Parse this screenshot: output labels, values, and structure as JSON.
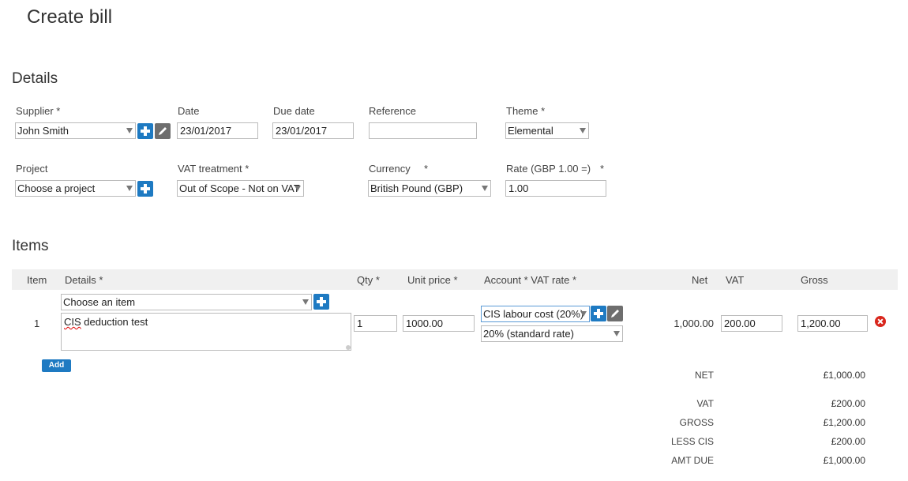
{
  "page_title": "Create bill",
  "details": {
    "heading": "Details",
    "supplier": {
      "label": "Supplier *",
      "value": "John Smith"
    },
    "date": {
      "label": "Date",
      "value": "23/01/2017"
    },
    "due_date": {
      "label": "Due date",
      "value": "23/01/2017"
    },
    "reference": {
      "label": "Reference",
      "value": ""
    },
    "theme": {
      "label": "Theme *",
      "value": "Elemental"
    },
    "project": {
      "label": "Project",
      "value": "Choose a project"
    },
    "vat_treatment": {
      "label": "VAT treatment *",
      "value": "Out of Scope - Not on VAT"
    },
    "currency": {
      "label": "Currency",
      "required_mark": "*",
      "value": "British Pound (GBP)"
    },
    "rate": {
      "label": "Rate (GBP 1.00 =)",
      "required_mark": "*",
      "value": "1.00"
    }
  },
  "items": {
    "heading": "Items",
    "columns": {
      "item": "Item",
      "details": "Details *",
      "qty": "Qty *",
      "unit_price": "Unit price *",
      "account_vat": "Account * VAT rate *",
      "net": "Net",
      "vat": "VAT",
      "gross": "Gross"
    },
    "rows": [
      {
        "item_no": "1",
        "item_select": "Choose an item",
        "details_prefix": "CIS",
        "details_rest": " deduction test",
        "qty": "1",
        "unit_price": "1000.00",
        "account": "CIS labour cost (20%)",
        "vat_rate": "20% (standard rate)",
        "net": "1,000.00",
        "vat": "200.00",
        "gross": "1,200.00"
      }
    ],
    "add_label": "Add"
  },
  "totals": [
    {
      "label": "NET",
      "value": "£1,000.00"
    },
    {
      "label": "VAT",
      "value": "£200.00"
    },
    {
      "label": "GROSS",
      "value": "£1,200.00"
    },
    {
      "label": "LESS CIS",
      "value": "£200.00"
    },
    {
      "label": "AMT DUE",
      "value": "£1,000.00"
    }
  ],
  "colors": {
    "accent": "#1e7ac2",
    "edit_button": "#6e6e6e",
    "delete": "#d9261c",
    "table_header": "#f0f0f0"
  },
  "icons": {
    "add": "plus-icon",
    "edit": "pencil-icon",
    "delete": "remove-circle-icon",
    "dropdown": "caret-down-icon"
  }
}
